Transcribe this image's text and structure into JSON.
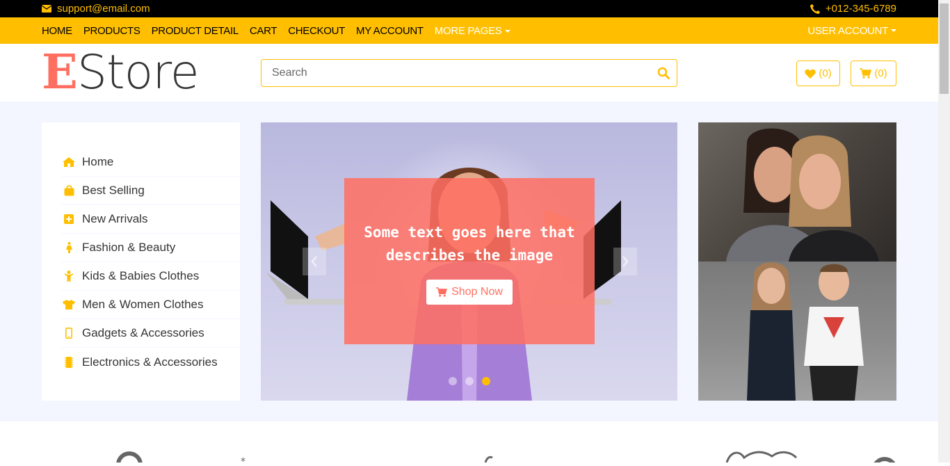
{
  "topbar": {
    "email": "support@email.com",
    "phone": "+012-345-6789"
  },
  "nav": {
    "links": [
      "HOME",
      "PRODUCTS",
      "PRODUCT DETAIL",
      "CART",
      "CHECKOUT",
      "MY ACCOUNT"
    ],
    "more_pages": "MORE PAGES",
    "user_account": "USER ACCOUNT"
  },
  "header": {
    "logo_first": "E",
    "logo_rest": "Store",
    "search_placeholder": "Search",
    "wishlist_count": "(0)",
    "cart_count": "(0)"
  },
  "sidebar": {
    "items": [
      {
        "label": "Home",
        "icon": "home-icon"
      },
      {
        "label": "Best Selling",
        "icon": "shopping-bag-icon"
      },
      {
        "label": "New Arrivals",
        "icon": "plus-square-icon"
      },
      {
        "label": "Fashion & Beauty",
        "icon": "female-icon"
      },
      {
        "label": "Kids & Babies Clothes",
        "icon": "child-icon"
      },
      {
        "label": "Men & Women Clothes",
        "icon": "tshirt-icon"
      },
      {
        "label": "Gadgets & Accessories",
        "icon": "mobile-icon"
      },
      {
        "label": "Electronics & Accessories",
        "icon": "microchip-icon"
      }
    ]
  },
  "slider": {
    "caption": "Some text goes here that describes the image",
    "button": "Shop Now",
    "active_slide": 2,
    "slide_count": 3
  },
  "colors": {
    "accent": "#FFBF00",
    "brand": "#FF6F61",
    "text": "#353535",
    "background": "#F3F6FF"
  }
}
